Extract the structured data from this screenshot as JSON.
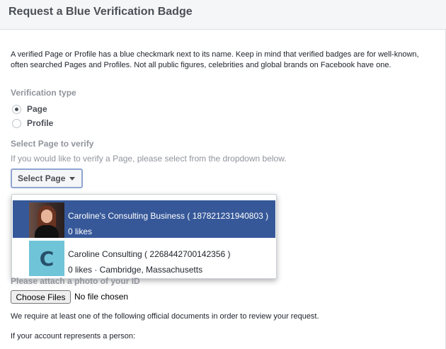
{
  "header": {
    "title": "Request a Blue Verification Badge"
  },
  "intro": "A verified Page or Profile has a blue checkmark next to its name. Keep in mind that verified badges are for well-known, often searched Pages and Profiles. Not all public figures, celebrities and global brands on Facebook have one.",
  "verification_type": {
    "label": "Verification type",
    "options": [
      {
        "label": "Page",
        "checked": true
      },
      {
        "label": "Profile",
        "checked": false
      }
    ]
  },
  "select_page": {
    "label": "Select Page to verify",
    "helper": "If you would like to verify a Page, please select from the dropdown below.",
    "button_label": "Select Page",
    "options": [
      {
        "title": "Caroline's Consulting Business ( 187821231940803 )",
        "subtitle": "0 likes",
        "selected": true,
        "thumb": "photo"
      },
      {
        "title": "Caroline Consulting ( 2268442700142356 )",
        "subtitle": "0 likes · Cambridge, Massachusetts",
        "selected": false,
        "thumb": "C"
      }
    ]
  },
  "attach": {
    "label": "Please attach a photo of your ID",
    "choose_files": "Choose Files",
    "file_status": "No file chosen"
  },
  "notes": {
    "require": "We require at least one of the following official documents in order to review your request.",
    "person": "If your account represents a person:"
  },
  "colors": {
    "selected_bg": "#365899",
    "muted_text": "#90949c",
    "thumb_c_bg": "#6fc4d8"
  }
}
